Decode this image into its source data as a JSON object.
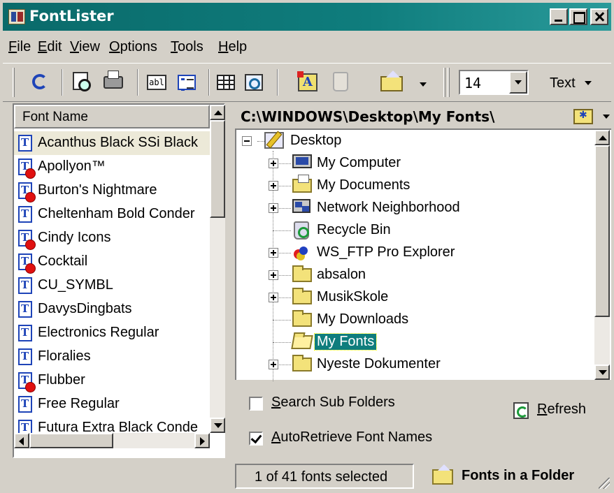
{
  "window": {
    "title": "FontLister"
  },
  "menu": [
    {
      "key": "F",
      "rest": "ile"
    },
    {
      "key": "E",
      "rest": "dit"
    },
    {
      "key": "V",
      "rest": "iew"
    },
    {
      "key": "O",
      "rest": "ptions"
    },
    {
      "key": "T",
      "rest": "ools"
    },
    {
      "key": "H",
      "rest": "elp"
    }
  ],
  "toolbar": {
    "font_size": "14",
    "text_button_label": "Text",
    "icons": [
      "refresh-icon",
      "print-preview-icon",
      "print-icon",
      "sample-text-icon",
      "details-icon",
      "table-icon",
      "find-icon",
      "install-font-icon",
      "recycle-icon",
      "folder-up-icon"
    ]
  },
  "font_list": {
    "column_header": "Font Name",
    "fonts": [
      {
        "name": "Acanthus Black SSi  Black",
        "warning": false,
        "selected": true
      },
      {
        "name": "Apollyon™",
        "warning": true,
        "selected": false
      },
      {
        "name": "Burton's Nightmare",
        "warning": true,
        "selected": false
      },
      {
        "name": "Cheltenham Bold Conder",
        "warning": false,
        "selected": false
      },
      {
        "name": "Cindy Icons",
        "warning": true,
        "selected": false
      },
      {
        "name": "Cocktail",
        "warning": true,
        "selected": false
      },
      {
        "name": "CU_SYMBL",
        "warning": false,
        "selected": false
      },
      {
        "name": "DavysDingbats",
        "warning": false,
        "selected": false
      },
      {
        "name": "Electronics Regular",
        "warning": false,
        "selected": false
      },
      {
        "name": "Floralies",
        "warning": false,
        "selected": false
      },
      {
        "name": "Flubber",
        "warning": true,
        "selected": false
      },
      {
        "name": "Free Regular",
        "warning": false,
        "selected": false
      },
      {
        "name": "Futura Extra Black Conde",
        "warning": false,
        "selected": false
      }
    ]
  },
  "folder_tree": {
    "path": "C:\\WINDOWS\\Desktop\\My Fonts\\",
    "root": "Desktop",
    "items": [
      {
        "label": "My Computer",
        "icon": "computer-icon",
        "expandable": true,
        "selected": false
      },
      {
        "label": "My Documents",
        "icon": "my-documents-icon",
        "expandable": true,
        "selected": false
      },
      {
        "label": "Network Neighborhood",
        "icon": "network-icon",
        "expandable": true,
        "selected": false
      },
      {
        "label": "Recycle Bin",
        "icon": "recycle-bin-icon",
        "expandable": false,
        "selected": false
      },
      {
        "label": "WS_FTP Pro Explorer",
        "icon": "ftp-icon",
        "expandable": true,
        "selected": false
      },
      {
        "label": "absalon",
        "icon": "folder-icon",
        "expandable": true,
        "selected": false
      },
      {
        "label": "MusikSkole",
        "icon": "folder-icon",
        "expandable": true,
        "selected": false
      },
      {
        "label": "My Downloads",
        "icon": "folder-icon",
        "expandable": false,
        "selected": false
      },
      {
        "label": "My Fonts",
        "icon": "open-folder-icon",
        "expandable": false,
        "selected": true
      },
      {
        "label": "Nyeste Dokumenter",
        "icon": "folder-icon",
        "expandable": true,
        "selected": false
      }
    ]
  },
  "options": {
    "search_sub_folders": {
      "key": "S",
      "rest": "earch Sub Folders",
      "checked": false
    },
    "auto_retrieve": {
      "key": "A",
      "rest": "utoRetrieve Font Names",
      "checked": true
    },
    "refresh": {
      "key": "R",
      "rest": "efresh"
    }
  },
  "status": {
    "selection": "1 of 41 fonts selected",
    "mode": "Fonts in a Folder"
  }
}
